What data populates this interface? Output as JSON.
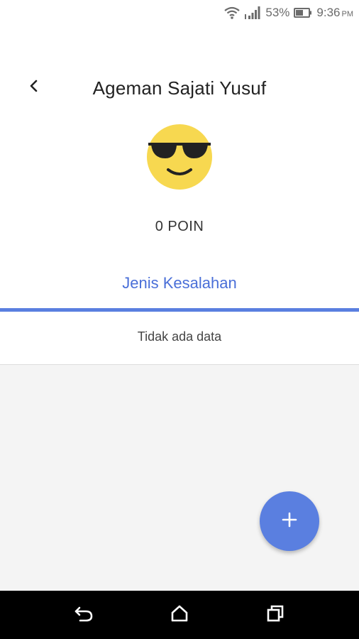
{
  "status_bar": {
    "battery_percent": "53%",
    "time": "9:36",
    "ampm": "PM",
    "icons": [
      "wifi-icon",
      "signal-icon",
      "battery-icon"
    ]
  },
  "header": {
    "back_icon": "chevron-left-icon",
    "title": "Ageman Sajati Yusuf"
  },
  "avatar": {
    "icon": "sunglasses-emoji-icon"
  },
  "points": {
    "value": "0",
    "unit": "POIN"
  },
  "tabs": [
    {
      "label": "Jenis Kesalahan",
      "active": true
    }
  ],
  "list": {
    "empty_text": "Tidak ada data"
  },
  "fab": {
    "icon": "plus-icon"
  },
  "nav_bar": {
    "icons": [
      "back-icon",
      "home-icon",
      "recents-icon"
    ]
  },
  "colors": {
    "accent": "#5a7fe0",
    "tab_text": "#4a6fd8",
    "emoji_yellow": "#f7d850",
    "background": "#f4f4f4"
  }
}
